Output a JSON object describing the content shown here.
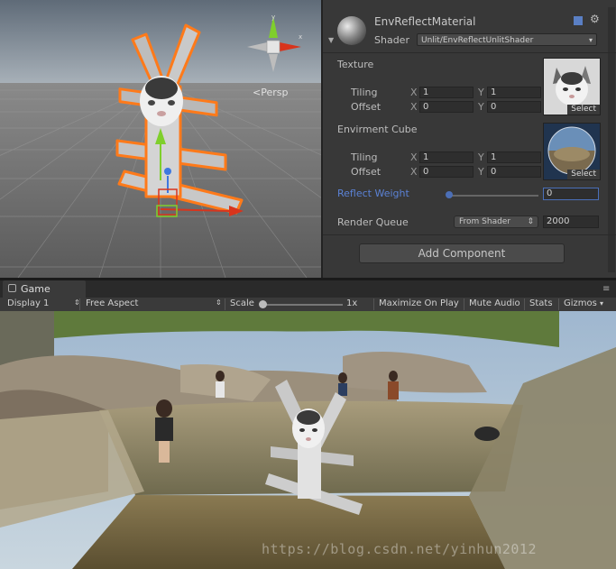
{
  "scene_view": {
    "persp_label": "Persp"
  },
  "inspector": {
    "material_name": "EnvReflectMaterial",
    "shader_label": "Shader",
    "shader_value": "Unlit/EnvReflectUnlitShader",
    "texture": {
      "label": "Texture",
      "tiling_label": "Tiling",
      "offset_label": "Offset",
      "x_label": "X",
      "y_label": "Y",
      "tiling_x": "1",
      "tiling_y": "1",
      "offset_x": "0",
      "offset_y": "0",
      "select_label": "Select"
    },
    "envirment_cube": {
      "label": "Envirment Cube",
      "tiling_label": "Tiling",
      "offset_label": "Offset",
      "x_label": "X",
      "y_label": "Y",
      "tiling_x": "1",
      "tiling_y": "1",
      "offset_x": "0",
      "offset_y": "0",
      "select_label": "Select"
    },
    "reflect_weight": {
      "label": "Reflect Weight",
      "value": "0"
    },
    "render_queue": {
      "label": "Render Queue",
      "mode": "From Shader",
      "value": "2000"
    },
    "add_component_label": "Add Component"
  },
  "game": {
    "tab_label": "Game",
    "display": "Display 1",
    "aspect": "Free Aspect",
    "scale_label": "Scale",
    "scale_value": "1x",
    "maximize_on_play": "Maximize On Play",
    "mute_audio": "Mute Audio",
    "stats": "Stats",
    "gizmos": "Gizmos"
  },
  "watermark": "https://blog.csdn.net/yinhun2012",
  "colors": {
    "selection_orange": "#ff7a1a",
    "axis_x": "#d8341c",
    "axis_y": "#7fcf2c",
    "axis_z": "#3d78e0",
    "highlight_blue": "#5b82d6"
  }
}
